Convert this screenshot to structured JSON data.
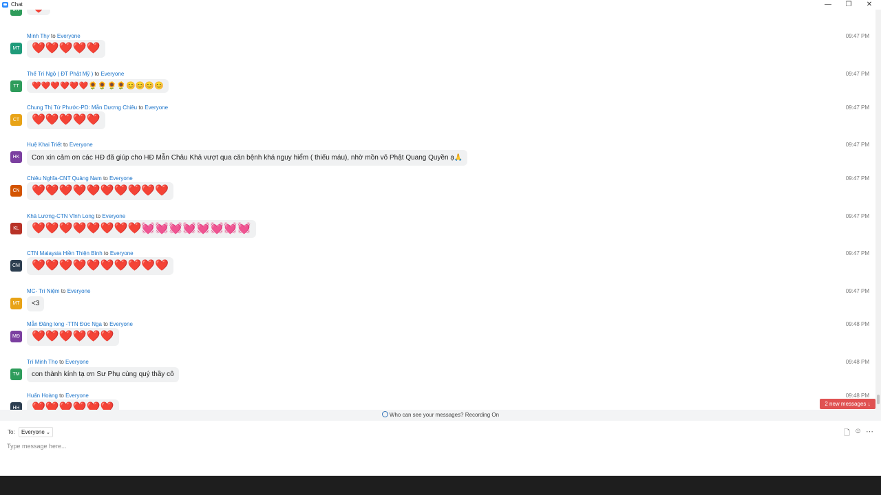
{
  "window": {
    "title": "Chat",
    "controls": {
      "minimize": "—",
      "restore": "❐",
      "close": "✕"
    }
  },
  "messages": [
    {
      "initials": "MT",
      "color": "#2e9c5b",
      "sender": "",
      "to_word": "",
      "recipient": "",
      "time": "",
      "text": "❤️",
      "kind": "emo"
    },
    {
      "initials": "MT",
      "color": "#1f9b7a",
      "sender": "Minh Thy",
      "to_word": "to",
      "recipient": "Everyone",
      "time": "09:47 PM",
      "text": "❤️❤️❤️❤️❤️",
      "kind": "emo"
    },
    {
      "initials": "TT",
      "color": "#2e9c5b",
      "sender": "Thể Trí Ngộ ( ĐT Phật Mỹ )",
      "to_word": "to",
      "recipient": "Everyone",
      "time": "09:47 PM",
      "text": "❤️❤️❤️❤️❤️❤️🌻🌻🌻🌻😊😊😊😊",
      "kind": "sm"
    },
    {
      "initials": "CT",
      "color": "#e8a317",
      "sender": "Chung Thị Tứ Phước-PD: Mẫn Dương Chiêu",
      "to_word": "to",
      "recipient": "Everyone",
      "time": "09:47 PM",
      "text": "❤️❤️❤️❤️❤️",
      "kind": "emo"
    },
    {
      "initials": "HK",
      "color": "#7b3fa0",
      "sender": "Huệ Khai Triết",
      "to_word": "to",
      "recipient": "Everyone",
      "time": "09:47 PM",
      "text": "Con xin cảm ơn các HĐ đã giúp cho HĐ Mẫn Châu Khả vượt qua căn bệnh khá nguy hiểm ( thiếu máu), nhờ mồn võ Phật Quang Quyền ạ🙏",
      "kind": "text"
    },
    {
      "initials": "CN",
      "color": "#d35400",
      "sender": "Chiêu Nghĩa-CNT Quảng Nam",
      "to_word": "to",
      "recipient": "Everyone",
      "time": "09:47 PM",
      "text": "❤️❤️❤️❤️❤️❤️❤️❤️❤️❤️",
      "kind": "emo"
    },
    {
      "initials": "KL",
      "color": "#b83227",
      "sender": "Khả Lương-CTN Vĩnh Long",
      "to_word": "to",
      "recipient": "Everyone",
      "time": "09:47 PM",
      "text": "❤️❤️❤️❤️❤️❤️❤️❤️💓💓💓💓💓💓💓💓",
      "kind": "emo"
    },
    {
      "initials": "CM",
      "color": "#2c3e50",
      "sender": "CTN Malaysia Hiền Thiện Bình",
      "to_word": "to",
      "recipient": "Everyone",
      "time": "09:47 PM",
      "text": "❤️❤️❤️❤️❤️❤️❤️❤️❤️❤️",
      "kind": "emo"
    },
    {
      "initials": "MT",
      "color": "#e8a317",
      "sender": "MC- Trí Niệm",
      "to_word": "to",
      "recipient": "Everyone",
      "time": "09:47 PM",
      "text": "<3",
      "kind": "text"
    },
    {
      "initials": "MĐ",
      "color": "#7b3fa0",
      "sender": "Mẫn Đăng long -TTN Đức Nga",
      "to_word": "to",
      "recipient": "Everyone",
      "time": "09:48 PM",
      "text": "❤️❤️❤️❤️❤️❤️",
      "kind": "emo"
    },
    {
      "initials": "TM",
      "color": "#2e9c5b",
      "sender": "Trí Minh Thọ",
      "to_word": "to",
      "recipient": "Everyone",
      "time": "09:48 PM",
      "text": "con thành kính tạ ơn Sư Phụ cùng quý thầy cô",
      "kind": "text"
    },
    {
      "initials": "HH",
      "color": "#2c3e50",
      "sender": "Huấn Hoàng",
      "to_word": "to",
      "recipient": "Everyone",
      "time": "09:48 PM",
      "text": "❤️❤️❤️❤️❤️❤️",
      "kind": "emo"
    }
  ],
  "info_bar": {
    "icon": "person-eye-icon",
    "text": "Who can see your messages? Recording On"
  },
  "new_messages": {
    "label": "2 new messages ↓"
  },
  "composer": {
    "to_label": "To:",
    "recipient": "Everyone",
    "placeholder": "Type message here..."
  }
}
